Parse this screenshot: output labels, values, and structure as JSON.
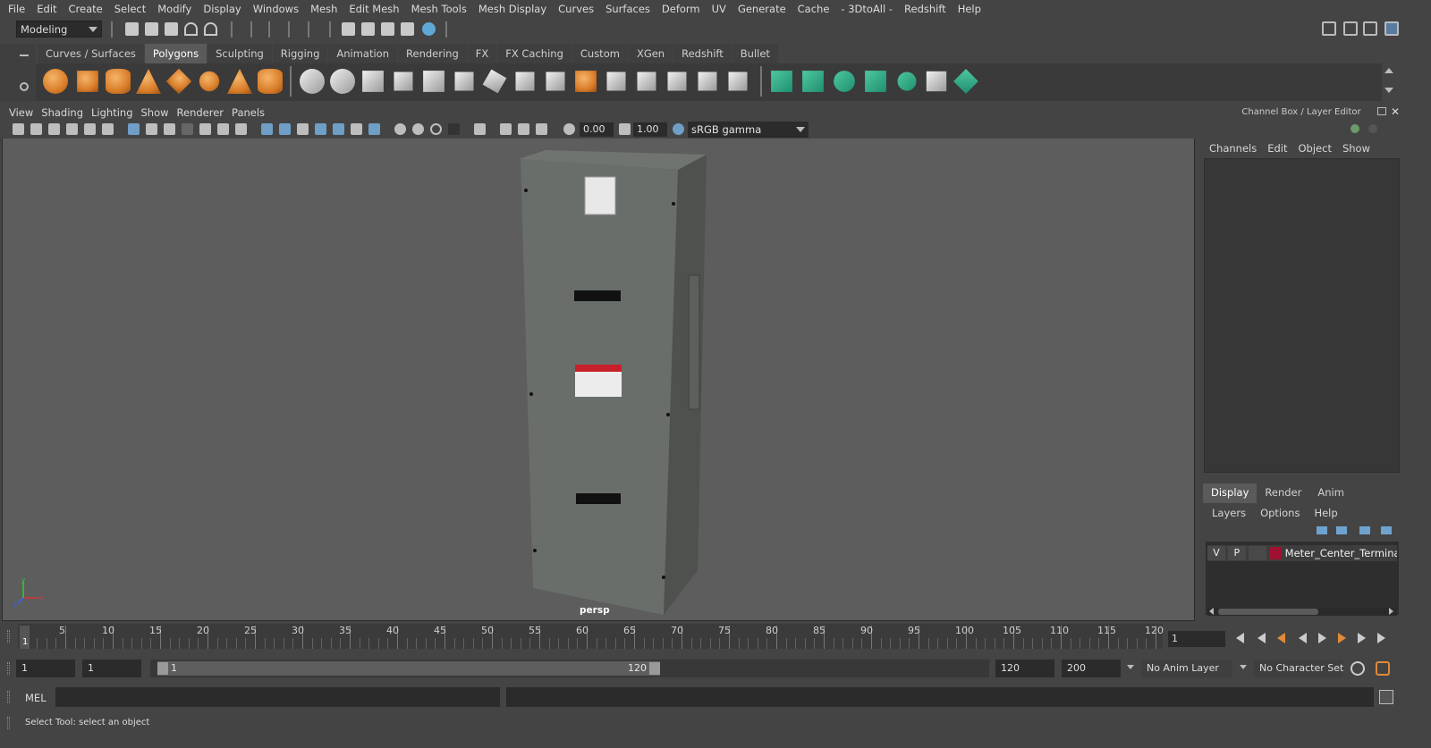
{
  "menubar": {
    "items": [
      "File",
      "Edit",
      "Create",
      "Select",
      "Modify",
      "Display",
      "Windows",
      "Mesh",
      "Edit Mesh",
      "Mesh Tools",
      "Mesh Display",
      "Curves",
      "Surfaces",
      "Deform",
      "UV",
      "Generate",
      "Cache",
      "- 3DtoAll -",
      "Redshift",
      "Help"
    ]
  },
  "statusline": {
    "mode": "Modeling"
  },
  "shelf": {
    "tabs": [
      "Curves / Surfaces",
      "Polygons",
      "Sculpting",
      "Rigging",
      "Animation",
      "Rendering",
      "FX",
      "FX Caching",
      "Custom",
      "XGen",
      "Redshift",
      "Bullet"
    ],
    "active_tab": "Polygons"
  },
  "viewport": {
    "menu": [
      "View",
      "Shading",
      "Lighting",
      "Show",
      "Renderer",
      "Panels"
    ],
    "exposure": "0.00",
    "gamma": "1.00",
    "color_space": "sRGB gamma",
    "camera": "persp",
    "axis": {
      "x": "x",
      "y": "y",
      "z": "z"
    }
  },
  "channel_box": {
    "title": "Channel Box / Layer Editor",
    "tabs": [
      "Channels",
      "Edit",
      "Object",
      "Show"
    ]
  },
  "layer_editor": {
    "tabs": [
      "Display",
      "Render",
      "Anim"
    ],
    "active_tab": "Display",
    "menu": [
      "Layers",
      "Options",
      "Help"
    ],
    "layer": {
      "visible": "V",
      "playback": "P",
      "color": "#a01030",
      "name": "Meter_Center_Terminal_B"
    }
  },
  "timeline": {
    "ticks": [
      "5",
      "10",
      "15",
      "20",
      "25",
      "30",
      "35",
      "40",
      "45",
      "50",
      "55",
      "60",
      "65",
      "70",
      "75",
      "80",
      "85",
      "90",
      "95",
      "100",
      "105",
      "110",
      "115",
      "120"
    ],
    "current_marker": "1",
    "current_frame": "1"
  },
  "range": {
    "start": "1",
    "playback_start": "1",
    "slider_start": "1",
    "slider_end": "120",
    "playback_end": "120",
    "end": "200",
    "anim_layer": "No Anim Layer",
    "character_set": "No Character Set"
  },
  "command_line": {
    "label": "MEL"
  },
  "help_line": {
    "text": "Select Tool: select an object"
  }
}
